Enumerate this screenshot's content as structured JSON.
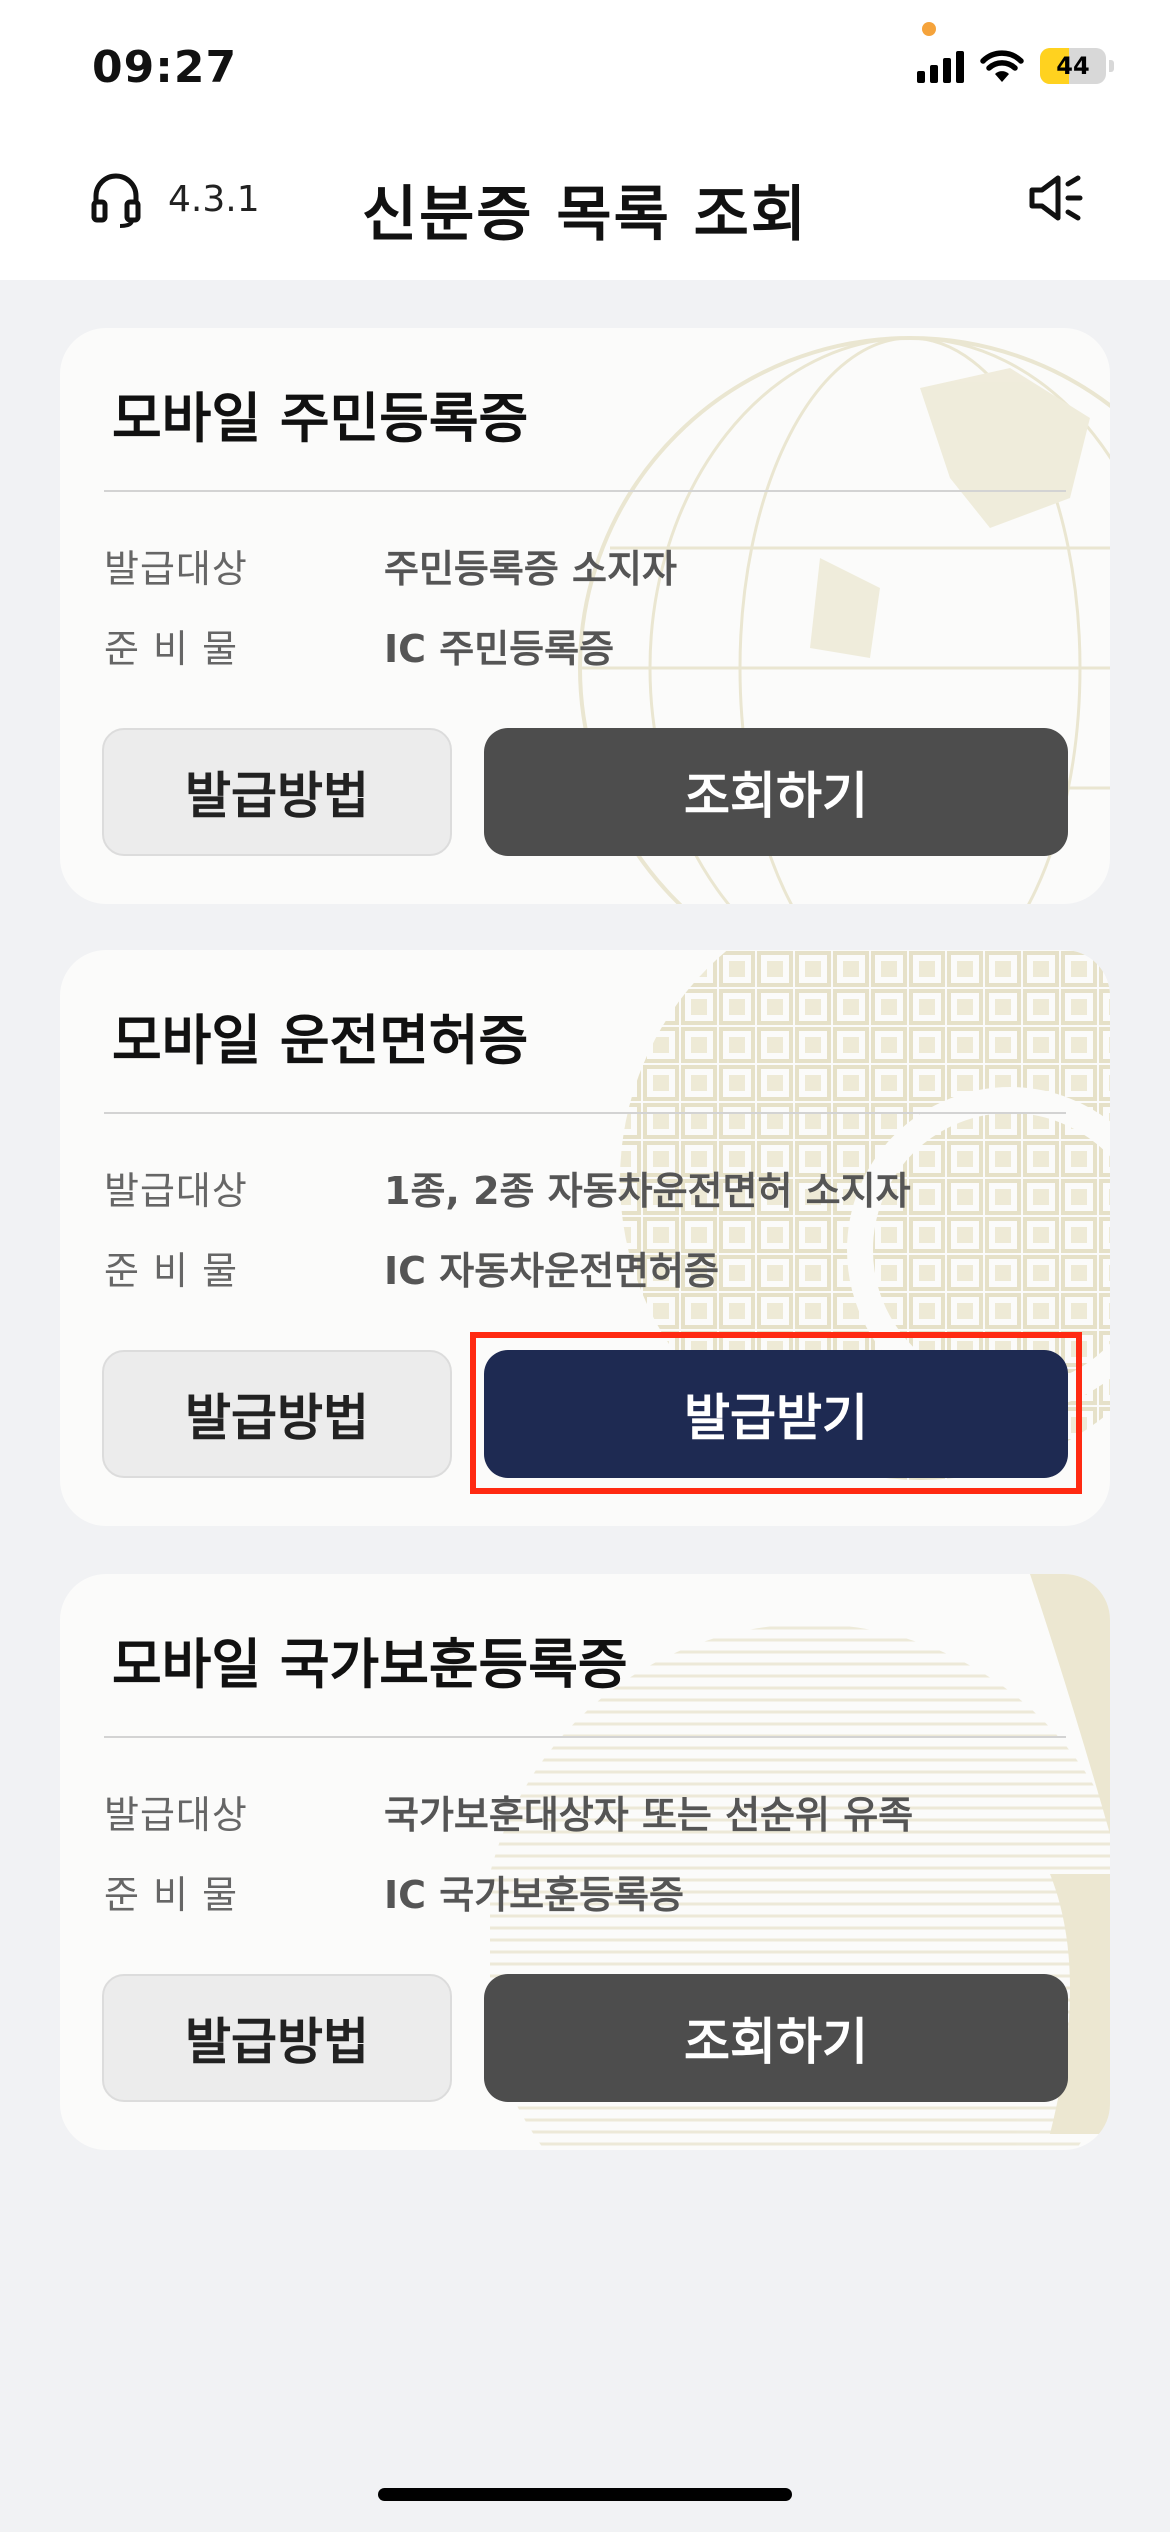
{
  "status_bar": {
    "time": "09:27",
    "battery": "44"
  },
  "header": {
    "version": "4.3.1",
    "title": "신분증 목록 조회"
  },
  "cards": [
    {
      "title": "모바일 주민등록증",
      "target_label": "발급대상",
      "target_value": "주민등록증 소지자",
      "prep_label": "준 비 물",
      "prep_value": "IC 주민등록증",
      "method_button": "발급방법",
      "action_button": "조회하기"
    },
    {
      "title": "모바일 운전면허증",
      "target_label": "발급대상",
      "target_value": "1종, 2종 자동차운전면허 소지자",
      "prep_label": "준 비 물",
      "prep_value": "IC 자동차운전면허증",
      "method_button": "발급방법",
      "action_button": "발급받기"
    },
    {
      "title": "모바일 국가보훈등록증",
      "target_label": "발급대상",
      "target_value": "국가보훈대상자 또는 선순위 유족",
      "prep_label": "준 비 물",
      "prep_value": "IC 국가보훈등록증",
      "method_button": "발급방법",
      "action_button": "조회하기"
    }
  ],
  "colors": {
    "highlight": "#ff2a12",
    "navy_button": "#1e2a52",
    "dark_button": "#4d4d4d"
  },
  "icons": [
    "headset-icon",
    "speaker-icon",
    "signal-icon",
    "wifi-icon",
    "battery-icon"
  ]
}
